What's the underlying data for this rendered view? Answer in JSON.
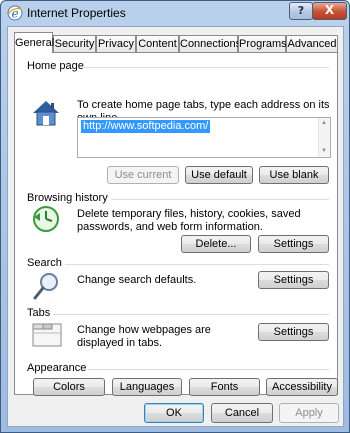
{
  "window": {
    "title": "Internet Properties",
    "help_label": "?",
    "close_label": "X"
  },
  "tabs": [
    {
      "label": "General",
      "active": true
    },
    {
      "label": "Security",
      "active": false
    },
    {
      "label": "Privacy",
      "active": false
    },
    {
      "label": "Content",
      "active": false
    },
    {
      "label": "Connections",
      "active": false
    },
    {
      "label": "Programs",
      "active": false
    },
    {
      "label": "Advanced",
      "active": false
    }
  ],
  "home_page": {
    "group_label": "Home page",
    "icon": "house-icon",
    "description": "To create home page tabs, type each address on its own line.",
    "url": "http://www.softpedia.com/",
    "use_current": "Use current",
    "use_default": "Use default",
    "use_blank": "Use blank"
  },
  "browsing_history": {
    "group_label": "Browsing history",
    "icon": "history-clock-icon",
    "description": "Delete temporary files, history, cookies, saved passwords, and web form information.",
    "delete_label": "Delete...",
    "settings_label": "Settings"
  },
  "search": {
    "group_label": "Search",
    "icon": "magnifier-icon",
    "description": "Change search defaults.",
    "settings_label": "Settings"
  },
  "tabs_section": {
    "group_label": "Tabs",
    "icon": "tabbed-window-icon",
    "description": "Change how webpages are displayed in tabs.",
    "settings_label": "Settings"
  },
  "appearance": {
    "group_label": "Appearance",
    "colors": "Colors",
    "languages": "Languages",
    "fonts": "Fonts",
    "accessibility": "Accessibility"
  },
  "footer": {
    "ok": "OK",
    "cancel": "Cancel",
    "apply": "Apply"
  },
  "colors": {
    "selection": "#3399ff",
    "title_gradient_top": "#b9d1ea",
    "close_button": "#c8563b"
  }
}
